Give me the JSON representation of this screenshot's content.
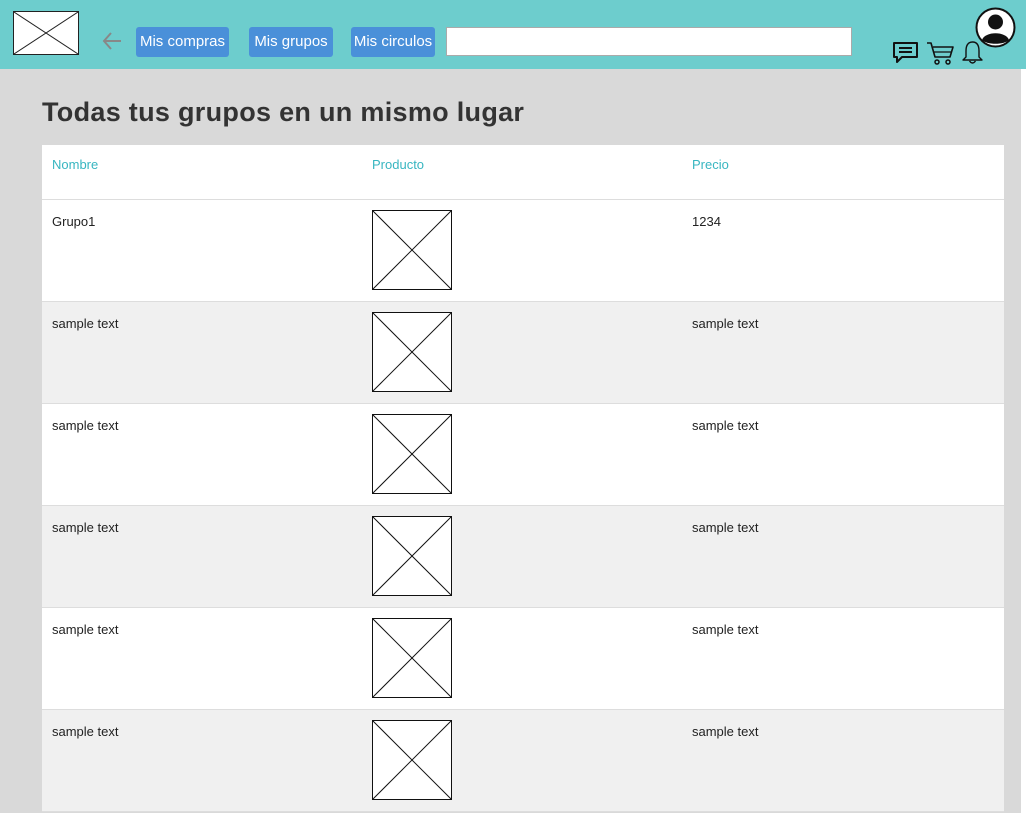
{
  "header": {
    "logo_icon": "image-placeholder-icon",
    "back_icon": "arrow-left-icon",
    "nav": [
      {
        "label": "Mis compras"
      },
      {
        "label": "Mis grupos"
      },
      {
        "label": "Mis circulos"
      }
    ],
    "search": {
      "value": "",
      "placeholder": ""
    },
    "icons": [
      "chat-icon",
      "cart-icon",
      "bell-icon",
      "user-avatar-icon"
    ]
  },
  "page": {
    "title": "Todas tus grupos en un mismo lugar"
  },
  "table": {
    "columns": [
      "Nombre",
      "Producto",
      "Precio"
    ],
    "rows": [
      {
        "nombre": "Grupo1",
        "producto": "image-placeholder-icon",
        "precio": "1234"
      },
      {
        "nombre": "sample text",
        "producto": "image-placeholder-icon",
        "precio": "sample text"
      },
      {
        "nombre": "sample text",
        "producto": "image-placeholder-icon",
        "precio": "sample text"
      },
      {
        "nombre": "sample text",
        "producto": "image-placeholder-icon",
        "precio": "sample text"
      },
      {
        "nombre": "sample text",
        "producto": "image-placeholder-icon",
        "precio": "sample text"
      },
      {
        "nombre": "sample text",
        "producto": "image-placeholder-icon",
        "precio": "sample text"
      }
    ]
  },
  "colors": {
    "header_bg": "#6dcdcd",
    "nav_button": "#4a90d9",
    "column_header": "#38b6c1",
    "page_bg": "#d9d9d9",
    "row_alt": "#f0f0f0"
  }
}
